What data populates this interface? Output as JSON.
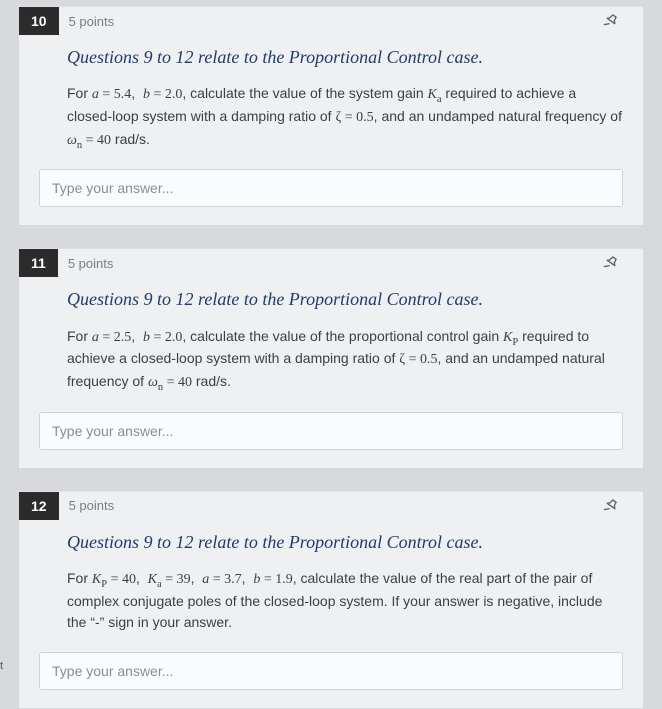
{
  "questions": [
    {
      "number": "10",
      "points": "5 points",
      "title": "Questions 9 to 12 relate to the Proportional Control case.",
      "body_html": "For <span class='math'><i>a</i> = 5.4</span>,&nbsp; <span class='math'><i>b</i> = 2.0</span>, calculate the value of the system gain <span class='math'><i>K</i><sub>a</sub></span> required to achieve a closed-loop system with a damping ratio of <span class='math'>ζ = 0.5</span>, and an undamped natural frequency of <span class='math'><i>ω</i><sub>n</sub> = 40</span> rad/s.",
      "placeholder": "Type your answer..."
    },
    {
      "number": "11",
      "points": "5 points",
      "title": "Questions 9 to 12 relate to the Proportional Control case.",
      "body_html": "For <span class='math'><i>a</i> = 2.5</span>,&nbsp; <span class='math'><i>b</i> = 2.0</span>, calculate the value of the proportional control gain <span class='math'><i>K</i><sub>P</sub></span> required to achieve a closed-loop system with a damping ratio of <span class='math'>ζ = 0.5</span>, and an undamped natural frequency of <span class='math'><i>ω</i><sub>n</sub> = 40</span> rad/s.",
      "placeholder": "Type your answer..."
    },
    {
      "number": "12",
      "points": "5 points",
      "title": "Questions 9 to 12 relate to the Proportional Control case.",
      "body_html": "For <span class='math'><i>K</i><sub>P</sub> = 40</span>,&nbsp; <span class='math'><i>K</i><sub>a</sub> = 39</span>,&nbsp; <span class='math'><i>a</i> = 3.7</span>,&nbsp; <span class='math'><i>b</i> = 1.9</span>, calculate the value of the real part of the pair of complex conjugate poles of the closed-loop system. If your answer is negative, include the “-” sign in your answer.",
      "placeholder": "Type your answer..."
    }
  ],
  "stray": {
    "l1": "",
    "l2": "t"
  }
}
